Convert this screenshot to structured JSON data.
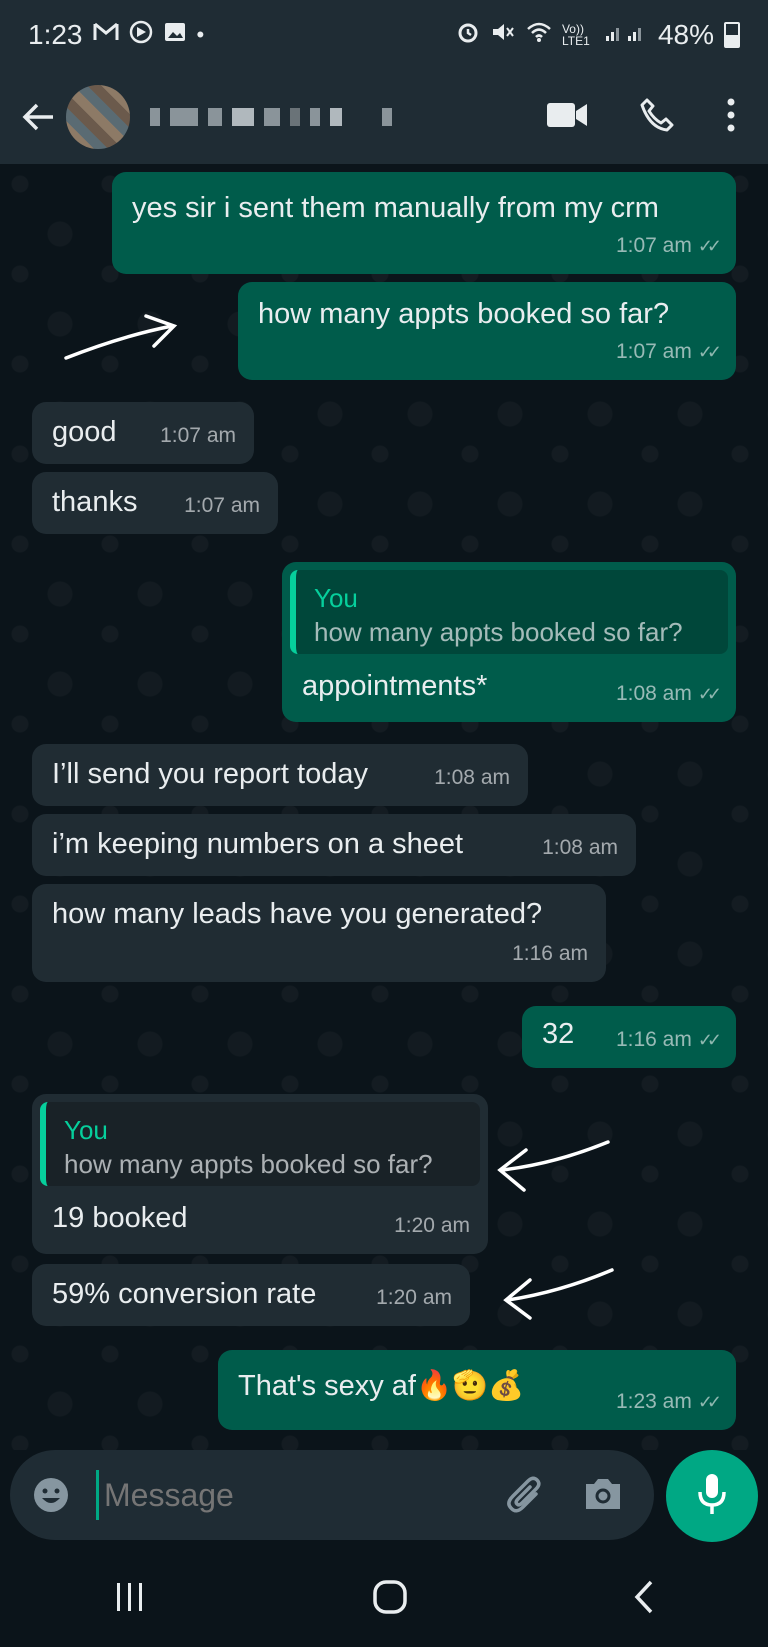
{
  "status_bar": {
    "time": "1:23",
    "left_icons": [
      "gmail-icon",
      "autoplay-icon",
      "gallery-icon",
      "dot-icon"
    ],
    "right_icons": [
      "alarm-icon",
      "mute-icon",
      "wifi-icon",
      "volte-icon",
      "signal-icon"
    ],
    "volte_label": "Vo)) LTE1",
    "battery": "48%"
  },
  "app_bar": {
    "contact_name_redacted": true,
    "actions": [
      "video-call-icon",
      "phone-call-icon",
      "more-options-icon"
    ]
  },
  "messages": [
    {
      "dir": "out",
      "text": "yes sir i sent them manually from my crm",
      "time": "1:07 am",
      "ticks": "read"
    },
    {
      "dir": "out",
      "text": "how many appts booked so far?",
      "time": "1:07 am",
      "ticks": "read"
    },
    {
      "dir": "in",
      "text": "good",
      "time": "1:07 am"
    },
    {
      "dir": "in",
      "text": "thanks",
      "time": "1:07 am"
    },
    {
      "dir": "out",
      "quote_author": "You",
      "quote_text": "how many appts booked so far?",
      "text": "appointments*",
      "time": "1:08 am",
      "ticks": "read"
    },
    {
      "dir": "in",
      "text": "I’ll send you report today",
      "time": "1:08 am"
    },
    {
      "dir": "in",
      "text": "i’m keeping numbers on a sheet",
      "time": "1:08 am"
    },
    {
      "dir": "in",
      "text": "how many leads have you generated?",
      "time": "1:16 am"
    },
    {
      "dir": "out",
      "text": "32",
      "time": "1:16 am",
      "ticks": "read"
    },
    {
      "dir": "in",
      "quote_author": "You",
      "quote_text": "how many appts booked so far?",
      "text": "19 booked",
      "time": "1:20 am"
    },
    {
      "dir": "in",
      "text": "59% conversion rate",
      "time": "1:20 am"
    },
    {
      "dir": "out",
      "text": "That's sexy af🔥🫡💰",
      "time": "1:23 am",
      "ticks": "read"
    }
  ],
  "composer": {
    "placeholder": "Message",
    "left_icon": "emoji-icon",
    "right_icons": [
      "attach-icon",
      "camera-icon"
    ],
    "send_icon": "mic-icon"
  },
  "nav_bar": {
    "buttons": [
      "recents-icon",
      "home-icon",
      "back-nav-icon"
    ]
  },
  "colors": {
    "outgoing_bubble": "#005c4b",
    "incoming_bubble": "#202c33",
    "accent": "#00a884",
    "header": "#1f2c34"
  }
}
